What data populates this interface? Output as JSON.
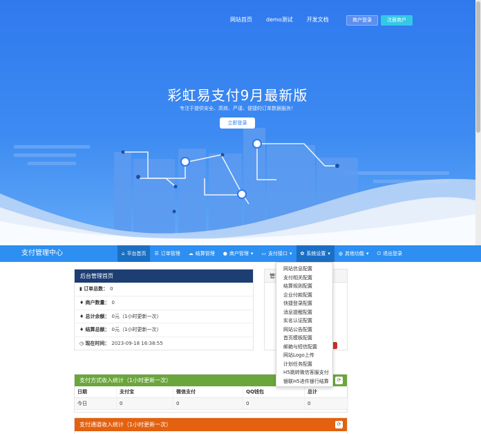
{
  "hero": {
    "nav": [
      "网站首页",
      "demo测试",
      "开发文档"
    ],
    "merchant_login": "商户登录",
    "register": "注册商户",
    "title": "彩虹易支付9月最新版",
    "subtitle": "专注于提供安全、高效、严谨、便捷的订单数据服务！",
    "login_button": "立即登录"
  },
  "navbar": {
    "brand": "支付管理中心",
    "items": [
      {
        "icon": "home-icon",
        "label": "平台首页"
      },
      {
        "icon": "list-icon",
        "label": "订单管理"
      },
      {
        "icon": "cloud-icon",
        "label": "结算管理"
      },
      {
        "icon": "user-icon",
        "label": "商户管理"
      },
      {
        "icon": "card-icon",
        "label": "支付接口"
      },
      {
        "icon": "gear-icon",
        "label": "系统设置"
      },
      {
        "icon": "globe-icon",
        "label": "其他功能"
      },
      {
        "icon": "power-icon",
        "label": "退出登录"
      }
    ]
  },
  "dropdown": [
    "网站信息配置",
    "支付相关配置",
    "结算规则配置",
    "企业付款配置",
    "快捷登录配置",
    "消息提醒配置",
    "实名认证配置",
    "网站公告配置",
    "首页模板配置",
    "邮箱与短信配置",
    "网站Logo上传",
    "计划任务配置",
    "H5跳转微信客服支付",
    "银联H5进件银行结算"
  ],
  "admin_panel": {
    "title": "后台管理首页",
    "rows": [
      {
        "icon": "bar-chart-icon",
        "label": "订单总数：",
        "value": "0",
        "note": ""
      },
      {
        "icon": "drop-icon",
        "label": "商户数量：",
        "value": "0",
        "note": ""
      },
      {
        "icon": "drop-icon",
        "label": "总计余额：",
        "value": "0元",
        "note": "（1小时更新一次）"
      },
      {
        "icon": "drop-icon",
        "label": "结算总额：",
        "value": "0元",
        "note": "（1小时更新一次）"
      },
      {
        "icon": "clock-icon",
        "label": "现在时间：",
        "value": "2023-09-18 16:38:55",
        "note": ""
      }
    ]
  },
  "side_panel": {
    "title": "管理"
  },
  "income_panel": {
    "title": "支付方式收入统计（1小时更新一次）",
    "headers": [
      "日期",
      "支付宝",
      "微信支付",
      "QQ钱包",
      "总计"
    ],
    "row": [
      "今日",
      "0",
      "0",
      "0",
      "0"
    ]
  },
  "channel_panel": {
    "title": "支付通道收入统计（1小时更新一次）"
  }
}
